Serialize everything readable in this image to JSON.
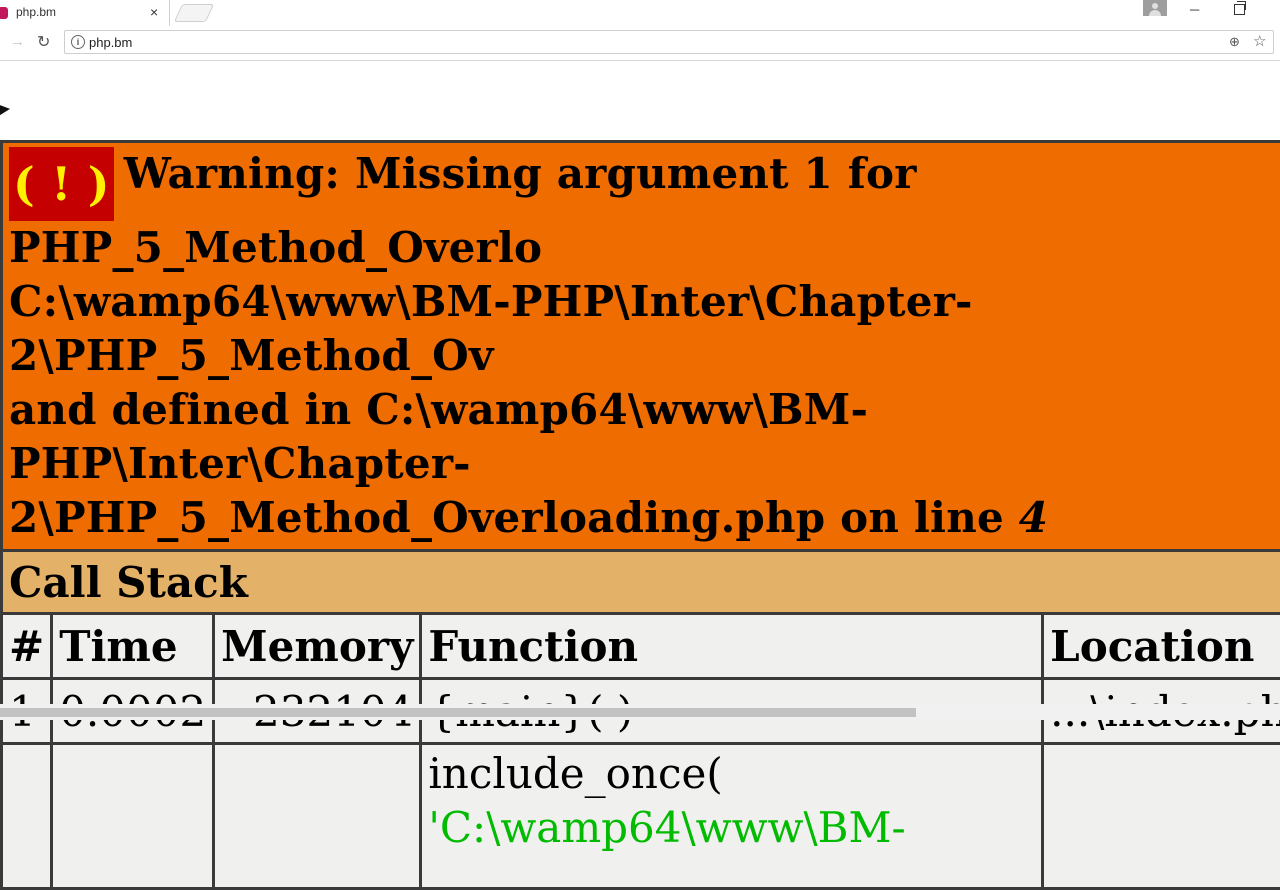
{
  "browser": {
    "tab_title": "php.bm",
    "tab_close": "×",
    "url": "php.bm"
  },
  "warning": {
    "badge": "( ! )",
    "line1": "Warning: Missing argument 1 for PHP_5_Method_Overlo",
    "line2": "C:\\wamp64\\www\\BM-PHP\\Inter\\Chapter-2\\PHP_5_Method_Ov",
    "line3": "and defined in C:\\wamp64\\www\\BM-PHP\\Inter\\Chapter-",
    "line4": "2\\PHP_5_Method_Overloading.php on line",
    "line_number": "4"
  },
  "call_stack": {
    "title": "Call Stack",
    "columns": [
      "#",
      "Time",
      "Memory",
      "Function",
      "Location"
    ],
    "rows": [
      {
        "num": "1",
        "time": "0.0002",
        "memory": "232104",
        "function": "{main}( )",
        "location": "...\\index.phi"
      },
      {
        "num": "",
        "time": "",
        "memory": "",
        "function": "include_once(",
        "function_arg": "'C:\\wamp64\\www\\BM-",
        "location": ""
      }
    ]
  },
  "colors": {
    "warning_bg": "#ee6c00",
    "badge_bg": "#c40000",
    "badge_fg": "#ffef00",
    "stack_header_bg": "#e4b169",
    "cell_bg": "#f0f0ee",
    "string_green": "#00bb00"
  }
}
